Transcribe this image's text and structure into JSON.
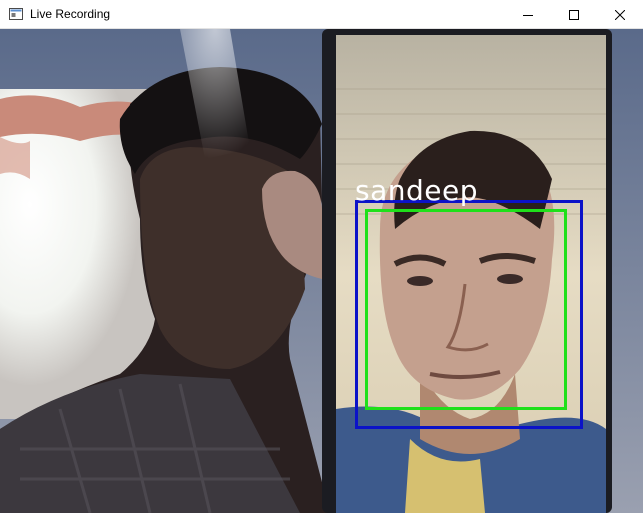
{
  "window": {
    "title": "Live Recording",
    "icon": "app-window-icon",
    "controls": [
      "minimize-icon",
      "maximize-icon",
      "close-icon"
    ]
  },
  "detection": {
    "label": "sandeep",
    "outer_box_color": "#0b12c8",
    "inner_box_color": "#1fe01a",
    "label_color": "#ffffff"
  }
}
